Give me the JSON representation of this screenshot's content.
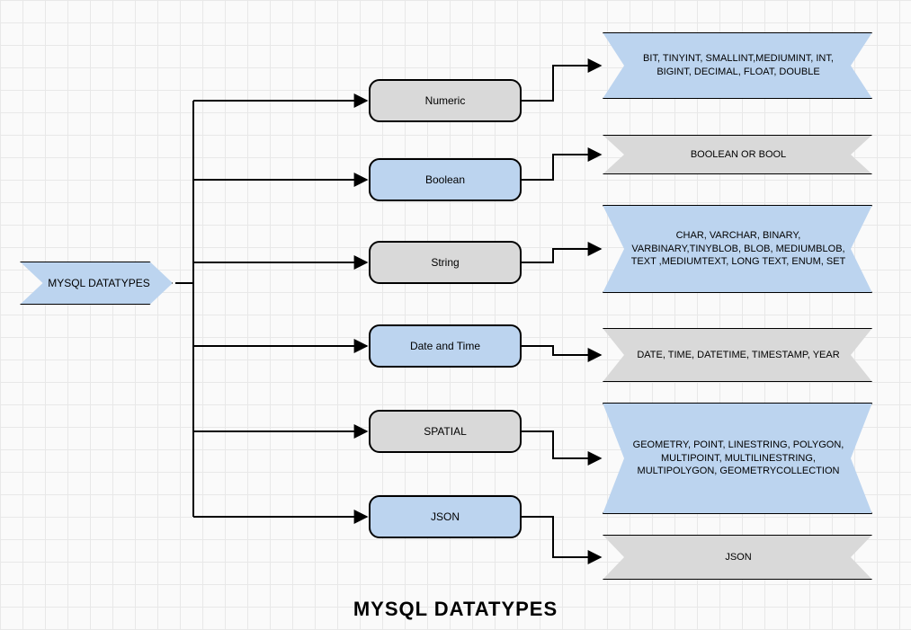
{
  "root_label": "MYSQL DATATYPES",
  "title": "MYSQL DATATYPES",
  "categories": [
    {
      "label": "Numeric",
      "detail": "BIT, TINYINT, SMALLINT,MEDIUMINT, INT, BIGINT, DECIMAL, FLOAT, DOUBLE"
    },
    {
      "label": "Boolean",
      "detail": "BOOLEAN OR BOOL"
    },
    {
      "label": "String",
      "detail": "CHAR, VARCHAR, BINARY, VARBINARY,TINYBLOB, BLOB, MEDIUMBLOB, TEXT ,MEDIUMTEXT, LONG TEXT, ENUM, SET"
    },
    {
      "label": "Date and Time",
      "detail": "DATE, TIME, DATETIME, TIMESTAMP, YEAR"
    },
    {
      "label": "SPATIAL",
      "detail": "GEOMETRY, POINT, LINESTRING, POLYGON, MULTIPOINT, MULTILINESTRING, MULTIPOLYGON, GEOMETRYCOLLECTION"
    },
    {
      "label": "JSON",
      "detail": "JSON"
    }
  ]
}
